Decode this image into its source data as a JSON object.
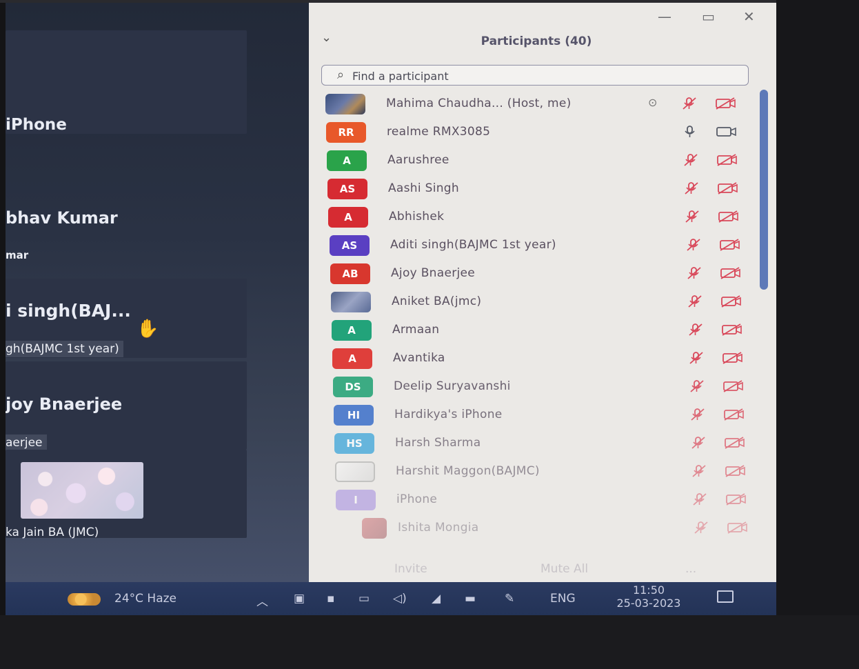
{
  "meeting": {
    "tiles": [
      {
        "name": "iPhone",
        "label": ""
      },
      {
        "name": "bhav Kumar",
        "label": "mar"
      },
      {
        "name": "i  singh(BAJ...",
        "label": "gh(BAJMC 1st year)"
      },
      {
        "name": "joy Bnaerjee",
        "label": "aerjee"
      },
      {
        "name": "",
        "label": "ka Jain BA (JMC)"
      }
    ],
    "hand_icon": "raised-hand"
  },
  "panel": {
    "title": "Participants (40)",
    "search_placeholder": "Find a participant",
    "participants": [
      {
        "name": "Mahima Chaudha... (Host, me)",
        "initials": "",
        "avatar": "photo",
        "color": "",
        "mic": "muted",
        "cam": "off",
        "share": true
      },
      {
        "name": "realme RMX3085",
        "initials": "RR",
        "avatar": "initials",
        "color": "#e8582a",
        "mic": "on",
        "cam": "on",
        "share": false
      },
      {
        "name": "Aarushree",
        "initials": "A",
        "avatar": "initials",
        "color": "#2aa34a",
        "mic": "muted",
        "cam": "off",
        "share": false
      },
      {
        "name": "Aashi Singh",
        "initials": "AS",
        "avatar": "initials",
        "color": "#d62b32",
        "mic": "muted",
        "cam": "off",
        "share": false
      },
      {
        "name": "Abhishek",
        "initials": "A",
        "avatar": "initials",
        "color": "#d62b32",
        "mic": "muted",
        "cam": "off",
        "share": false
      },
      {
        "name": "Aditi singh(BAJMC 1st year)",
        "initials": "AS",
        "avatar": "initials",
        "color": "#5a3fc2",
        "mic": "muted",
        "cam": "off",
        "share": false
      },
      {
        "name": "Ajoy Bnaerjee",
        "initials": "AB",
        "avatar": "initials",
        "color": "#d8372e",
        "mic": "muted",
        "cam": "off",
        "share": false
      },
      {
        "name": "Aniket BA(jmc)",
        "initials": "",
        "avatar": "photo2",
        "color": "",
        "mic": "muted",
        "cam": "off",
        "share": false
      },
      {
        "name": "Armaan",
        "initials": "A",
        "avatar": "initials",
        "color": "#22a37a",
        "mic": "muted",
        "cam": "off",
        "share": false
      },
      {
        "name": "Avantika",
        "initials": "A",
        "avatar": "initials",
        "color": "#df3f3b",
        "mic": "muted",
        "cam": "off",
        "share": false
      },
      {
        "name": "Deelip Suryavanshi",
        "initials": "DS",
        "avatar": "initials",
        "color": "#2aa579",
        "mic": "muted",
        "cam": "off",
        "share": false
      },
      {
        "name": "Hardikya's iPhone",
        "initials": "HI",
        "avatar": "initials",
        "color": "#2f66c8",
        "mic": "muted",
        "cam": "off",
        "share": false
      },
      {
        "name": "Harsh Sharma",
        "initials": "HS",
        "avatar": "initials",
        "color": "#2fa0d8",
        "mic": "muted",
        "cam": "off",
        "share": false
      },
      {
        "name": "Harshit Maggon(BAJMC)",
        "initials": "",
        "avatar": "photo3",
        "color": "",
        "mic": "muted",
        "cam": "off",
        "share": false
      },
      {
        "name": "iPhone",
        "initials": "I",
        "avatar": "initials",
        "color": "#9a80df",
        "mic": "muted",
        "cam": "off",
        "share": false
      },
      {
        "name": "Ishita Mongia",
        "initials": "",
        "avatar": "photo4",
        "color": "",
        "mic": "muted",
        "cam": "off",
        "share": false
      }
    ],
    "footer": {
      "invite": "Invite",
      "mute_all": "Mute All",
      "more": "..."
    }
  },
  "taskbar": {
    "weather": "24°C  Haze",
    "language": "ENG",
    "time": "11:50",
    "date": "25-03-2023"
  },
  "colors": {
    "muted_icon": "#d9485a",
    "accent": "#5d79b8"
  }
}
